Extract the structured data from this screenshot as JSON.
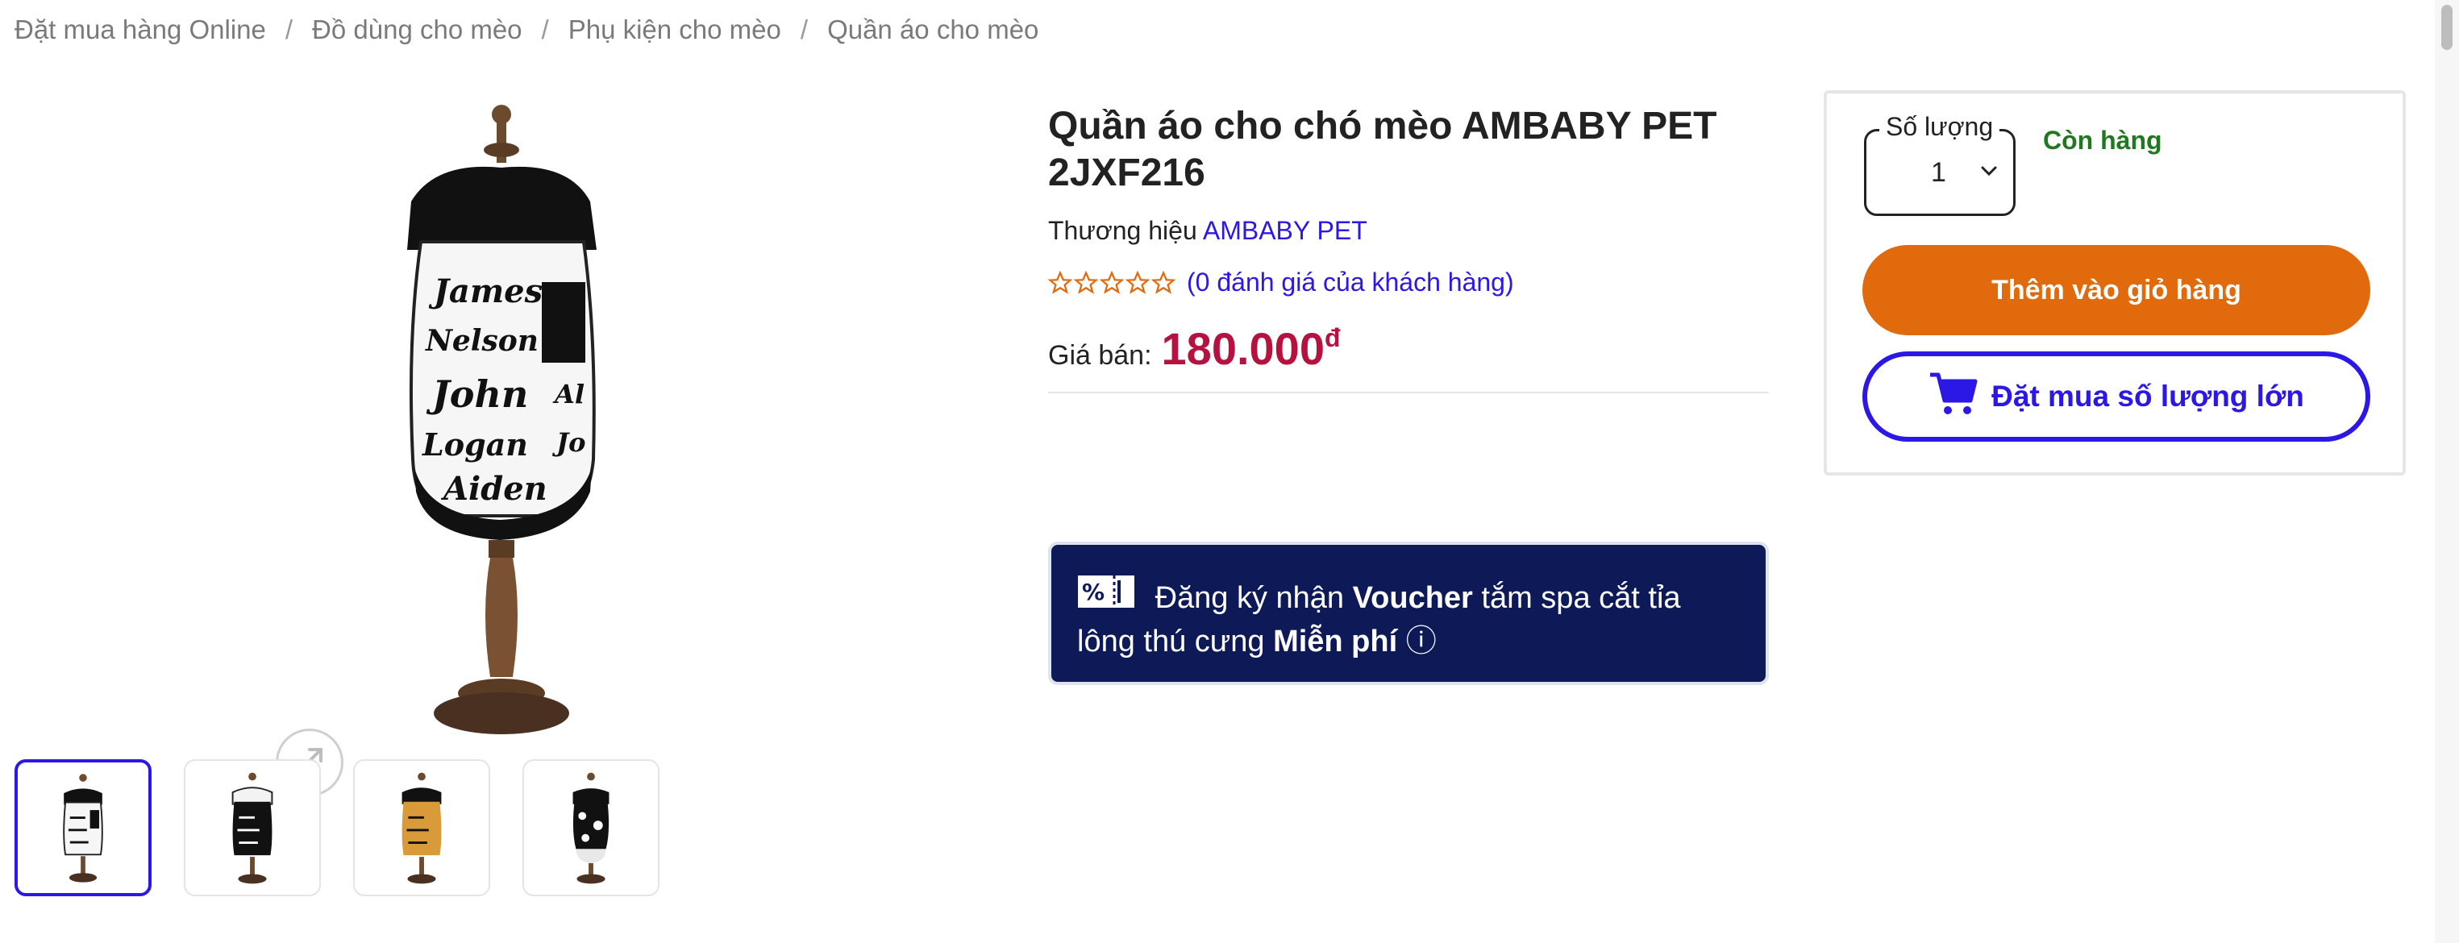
{
  "breadcrumb": [
    {
      "label": "Đặt mua hàng Online"
    },
    {
      "label": "Đồ dùng cho mèo"
    },
    {
      "label": "Phụ kiện cho mèo"
    },
    {
      "label": "Quần áo cho mèo"
    }
  ],
  "breadcrumb_separator": "/",
  "product": {
    "title": "Quần áo cho chó mèo AMBABY PET 2JXF216",
    "brand_label": "Thương hiệu",
    "brand_name": "AMBABY PET",
    "stars_total": 5,
    "stars_filled": 0,
    "review_text": "(0 đánh giá của khách hàng)",
    "price_label": "Giá bán:",
    "price_value": "180.000",
    "price_currency": "đ"
  },
  "gallery": {
    "thumbnail_count": 4,
    "active_thumbnail": 1
  },
  "voucher": {
    "icon": "percent-ticket-icon",
    "text_part1": "Đăng ký nhận",
    "text_bold1": "Voucher",
    "text_part2": "tắm spa cắt tỉa lông thú cưng",
    "text_bold2": "Miễn phí",
    "info_glyph": "ⓘ"
  },
  "buybox": {
    "quantity_label": "Số lượng",
    "quantity_value": "1",
    "stock_status": "Còn hàng",
    "add_to_cart_label": "Thêm vào giỏ hàng",
    "bulk_order_label": "Đặt mua số lượng lớn"
  },
  "colors": {
    "accent_blue": "#2b17e6",
    "orange_button": "#e06a0c",
    "price_red": "#b5123f",
    "voucher_navy": "#0d1a57",
    "stock_green": "#1f7a1f"
  }
}
